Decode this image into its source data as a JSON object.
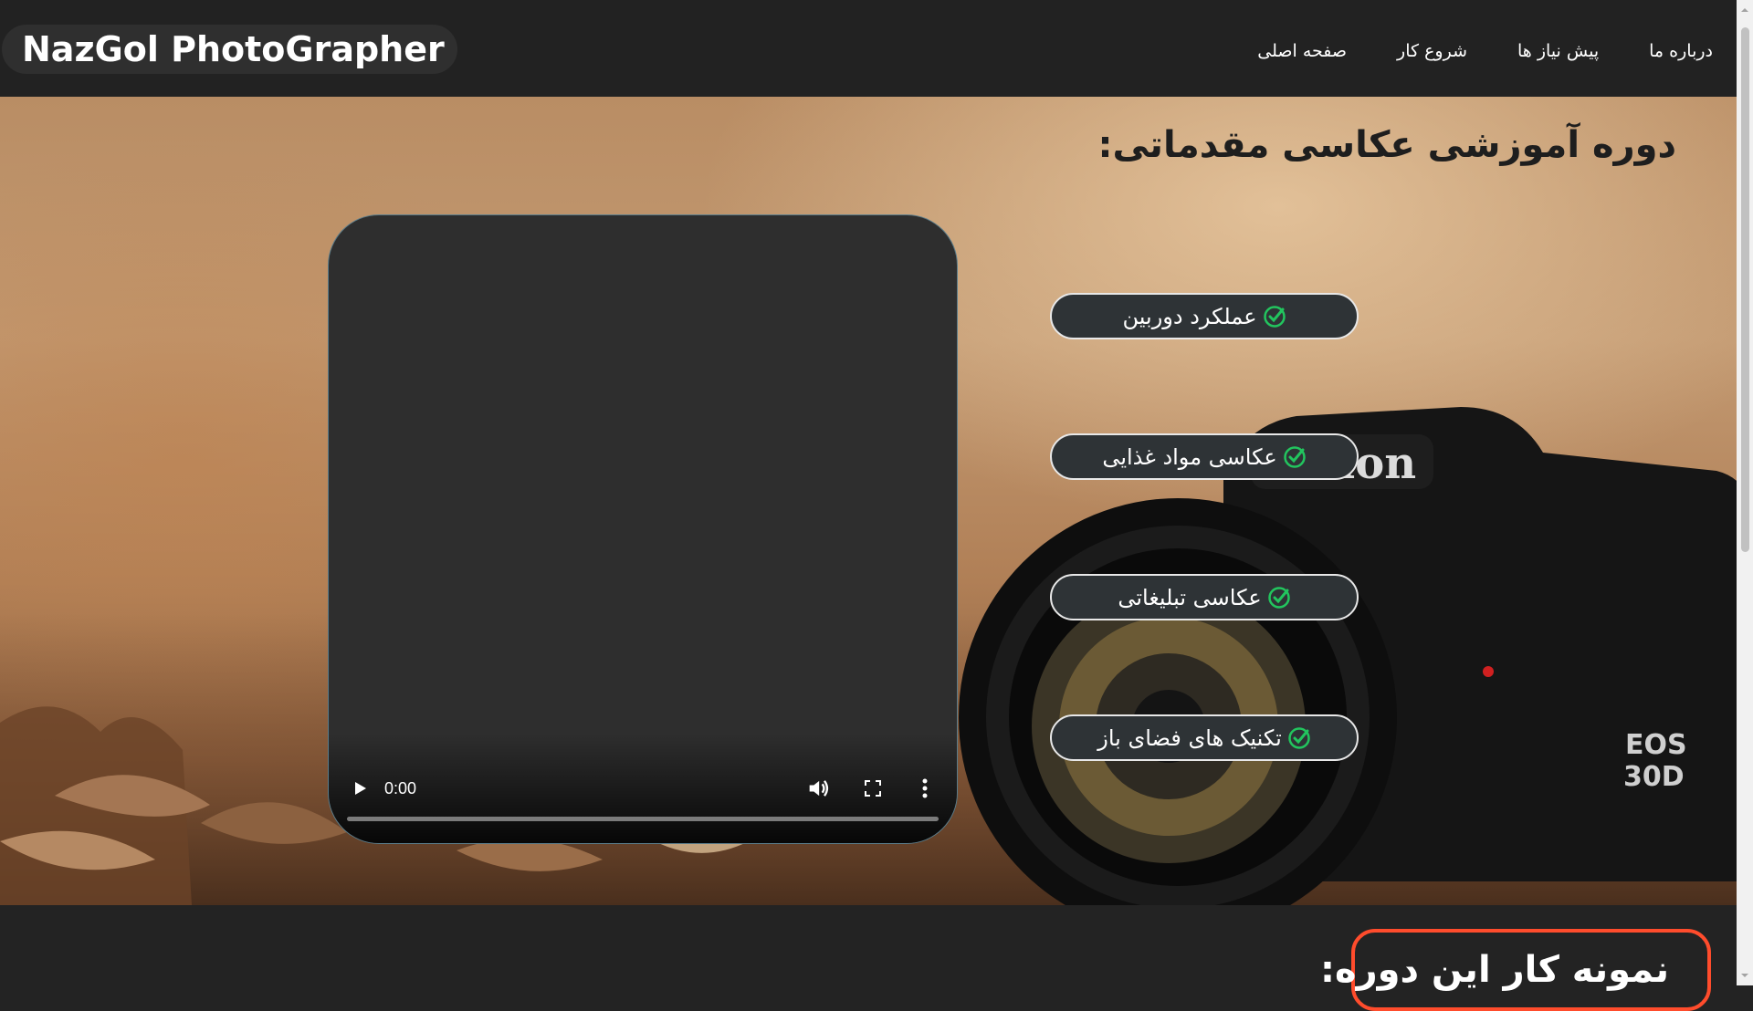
{
  "header": {
    "logo_text": "NazGol PhotoGrapher",
    "nav": [
      {
        "label": "صفحه اصلی"
      },
      {
        "label": "شروع کار"
      },
      {
        "label": "پیش نیاز ها"
      },
      {
        "label": "درباره ما"
      }
    ]
  },
  "hero": {
    "title": "دوره آموزشی عکاسی مقدماتی:",
    "video": {
      "time": "0:00",
      "progress": 0,
      "play_icon": "play-icon",
      "volume_icon": "volume-icon",
      "fullscreen_icon": "fullscreen-icon",
      "more_icon": "more-vertical-icon"
    },
    "topics": [
      {
        "label": "عملکرد دوربین",
        "icon": "check-circle-icon"
      },
      {
        "label": "عکاسی مواد غذایی",
        "icon": "check-circle-icon"
      },
      {
        "label": "عکاسی تبلیغاتی",
        "icon": "check-circle-icon"
      },
      {
        "label": "تکنیک های فضای باز",
        "icon": "check-circle-icon"
      }
    ],
    "background_image_text": "Canon EOS 30D"
  },
  "samples": {
    "title": "نمونه کار این دوره:"
  },
  "colors": {
    "header_bg": "#222222",
    "pill_bg": "#2e3336",
    "check_green": "#22c55e",
    "section_border": "#ff4c2c"
  }
}
